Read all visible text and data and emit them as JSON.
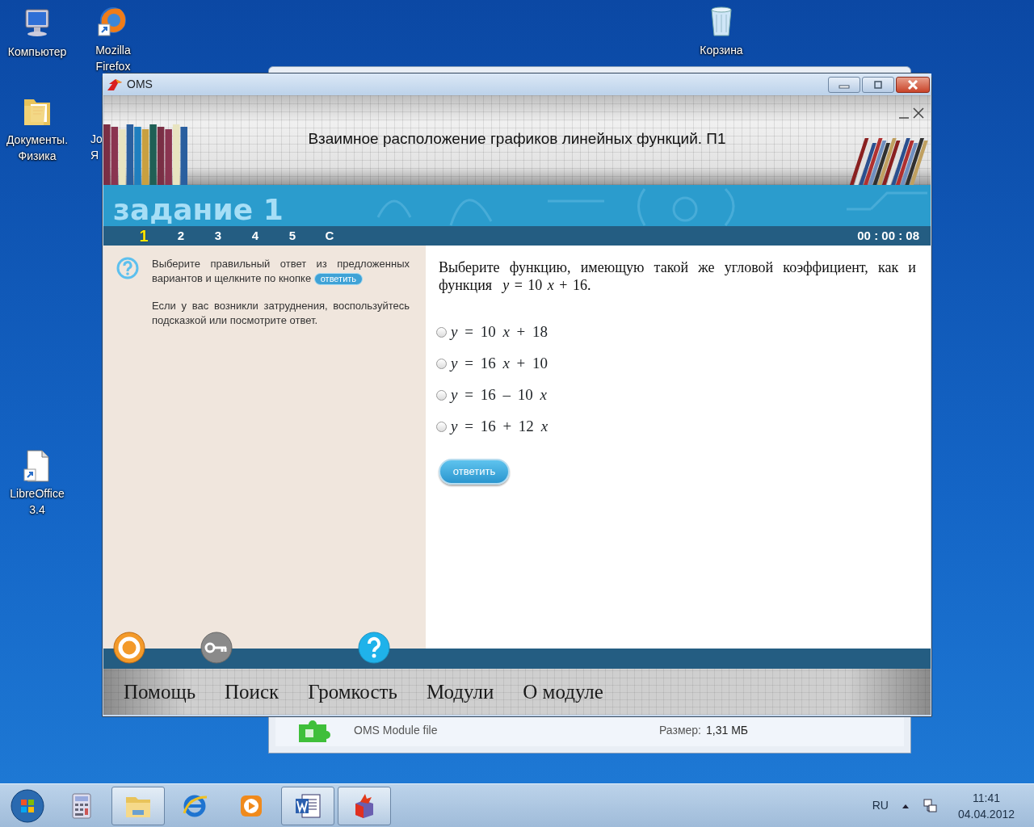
{
  "desktop_icons": [
    {
      "kind": "computer",
      "label": "Компьютер"
    },
    {
      "kind": "firefox",
      "label": "Mozilla Firefox"
    },
    {
      "kind": "trash",
      "label": "Корзина"
    },
    {
      "kind": "folder",
      "label": "Документы. Физика"
    },
    {
      "kind": "cut",
      "label": "Jo Я"
    },
    {
      "kind": "document",
      "label": "LibreOffice 3.4"
    }
  ],
  "background_window": {
    "file_type": "OMS Module file",
    "size_label": "Размер:",
    "size_value": "1,31 МБ"
  },
  "window": {
    "title": "OMS"
  },
  "lesson": {
    "title": "Взаимное расположение графиков линейных функций. П1",
    "task_heading": "задание 1",
    "tabs": [
      {
        "label": "1",
        "selected": true
      },
      {
        "label": "2",
        "selected": false
      },
      {
        "label": "3",
        "selected": false
      },
      {
        "label": "4",
        "selected": false
      },
      {
        "label": "5",
        "selected": false
      },
      {
        "label": "С",
        "selected": false
      }
    ],
    "timer": "00 : 00 : 08"
  },
  "instructions": {
    "text": "Выберите правильный ответ из предложенных вариантов и щелкните по кнопке",
    "inline_button": "ответить",
    "hint": "Если у вас возникли затруднения, воспользуйтесь подсказкой или посмотрите ответ."
  },
  "question": {
    "text": "Выберите функцию, имеющую такой же угловой коэффициент, как и функция  *y* = 10 *x* + 16.",
    "options": [
      {
        "formula": "*y* = 10 *x* + 18",
        "selected": false
      },
      {
        "formula": "*y* = 16 *x* + 10",
        "selected": false
      },
      {
        "formula": "*y* = 16 – 10 *x*",
        "selected": false
      },
      {
        "formula": "*y* = 16 + 12 *x*",
        "selected": false
      }
    ],
    "submit": "ответить"
  },
  "bottom_menu": [
    "Помощь",
    "Поиск",
    "Громкость",
    "Модули",
    "О модуле"
  ],
  "taskbar": {
    "items": [
      {
        "kind": "calculator",
        "active": false
      },
      {
        "kind": "folder",
        "active": true
      },
      {
        "kind": "browser",
        "active": false
      },
      {
        "kind": "media",
        "active": false
      },
      {
        "kind": "word",
        "active": true
      },
      {
        "kind": "oms",
        "active": true
      }
    ],
    "language": "RU",
    "time": "11:41",
    "date": "04.04.2012"
  }
}
